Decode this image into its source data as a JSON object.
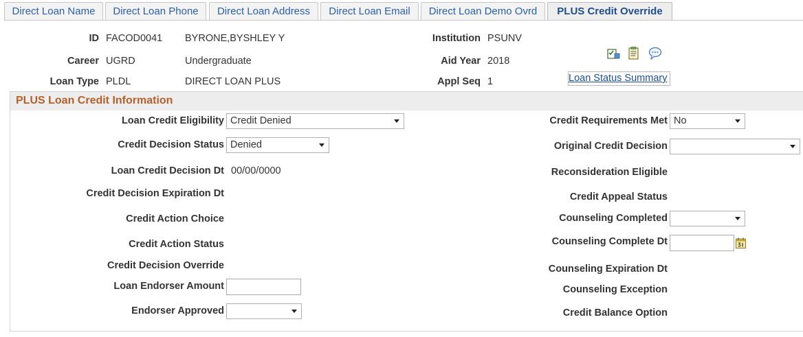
{
  "tabs": [
    {
      "label": "Direct Loan Name"
    },
    {
      "label": "Direct Loan Phone"
    },
    {
      "label": "Direct Loan Address"
    },
    {
      "label": "Direct Loan Email"
    },
    {
      "label": "Direct Loan Demo Ovrd"
    },
    {
      "label": "PLUS Credit Override",
      "active": true
    }
  ],
  "header": {
    "id_label": "ID",
    "id_value": "FACOD0041",
    "name": "BYRONE,BYSHLEY Y",
    "career_label": "Career",
    "career_value": "UGRD",
    "career_desc": "Undergraduate",
    "loan_type_label": "Loan Type",
    "loan_type_value": "PLDL",
    "loan_type_desc": "DIRECT LOAN PLUS",
    "institution_label": "Institution",
    "institution_value": "PSUNV",
    "aid_year_label": "Aid Year",
    "aid_year_value": "2018",
    "appl_seq_label": "Appl Seq",
    "appl_seq_value": "1",
    "status_summary_link": "Loan Status Summary",
    "icons": [
      "checklist-icon",
      "notes-icon",
      "comments-icon"
    ]
  },
  "section": {
    "title": "PLUS Loan Credit Information",
    "left": {
      "loan_credit_eligibility_label": "Loan Credit Eligibility",
      "loan_credit_eligibility_value": "Credit Denied",
      "credit_decision_status_label": "Credit Decision Status",
      "credit_decision_status_value": "Denied",
      "loan_credit_decision_dt_label": "Loan Credit Decision Dt",
      "loan_credit_decision_dt_value": "00/00/0000",
      "credit_decision_expiration_label": "Credit Decision Expiration Dt",
      "credit_action_choice_label": "Credit Action Choice",
      "credit_action_status_label": "Credit Action Status",
      "credit_decision_override_label": "Credit Decision Override",
      "loan_endorser_amount_label": "Loan Endorser Amount",
      "loan_endorser_amount_value": "",
      "endorser_approved_label": "Endorser Approved",
      "endorser_approved_value": ""
    },
    "right": {
      "credit_requirements_met_label": "Credit Requirements Met",
      "credit_requirements_met_value": "No",
      "original_credit_decision_label": "Original Credit Decision",
      "original_credit_decision_value": "",
      "reconsideration_eligible_label": "Reconsideration Eligible",
      "credit_appeal_status_label": "Credit Appeal Status",
      "counseling_completed_label": "Counseling Completed",
      "counseling_completed_value": "",
      "counseling_complete_dt_label": "Counseling Complete Dt",
      "counseling_complete_dt_value": "",
      "counseling_expiration_dt_label": "Counseling Expiration Dt",
      "counseling_exception_label": "Counseling Exception",
      "credit_balance_option_label": "Credit Balance Option"
    }
  },
  "colors": {
    "section_title": "#b4602a",
    "link": "#1f4e8c",
    "tab_text": "#2b5fa8"
  }
}
